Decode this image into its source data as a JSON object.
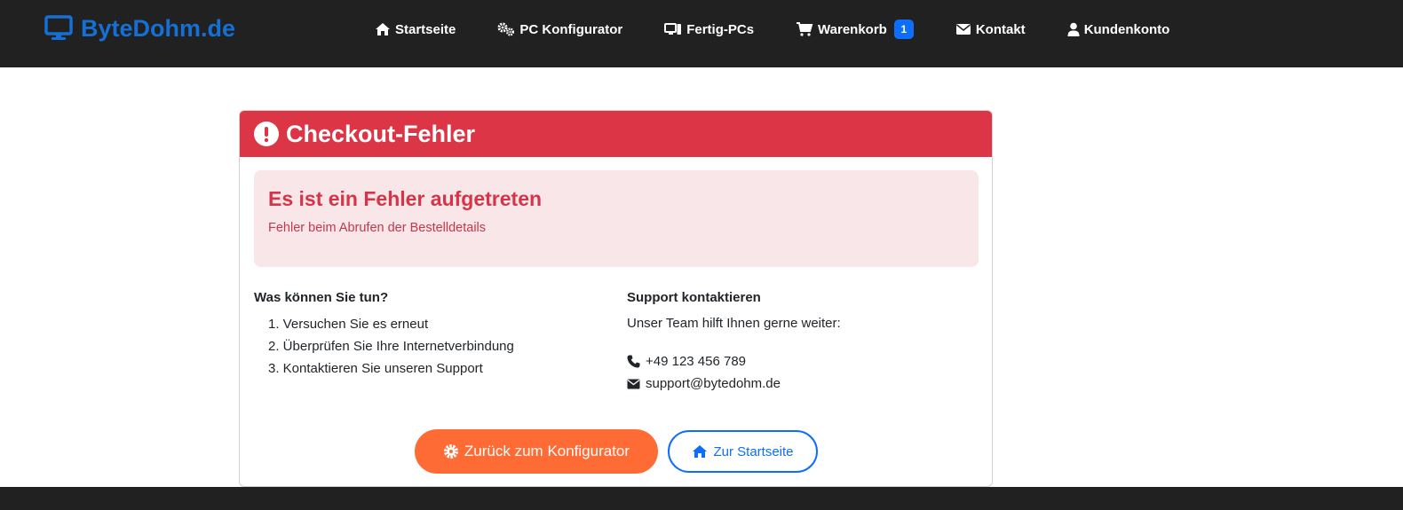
{
  "navbar": {
    "brand": {
      "label": "ByteDohm.de",
      "icon": "monitor-icon",
      "color": "#1570d6"
    },
    "items": [
      {
        "label": "Startseite",
        "icon": "home-icon"
      },
      {
        "label": "PC Konfigurator",
        "icon": "gears-icon"
      },
      {
        "label": "Fertig-PCs",
        "icon": "desktop-icon"
      },
      {
        "label": "Warenkorb",
        "icon": "cart-icon",
        "badge": "1"
      },
      {
        "label": "Kontakt",
        "icon": "envelope-icon"
      },
      {
        "label": "Kundenkonto",
        "icon": "user-icon"
      }
    ],
    "background": "#212121"
  },
  "card": {
    "title": "Checkout-Fehler",
    "header_icon": "exclamation-circle-icon",
    "header_color": "#dc3545",
    "alert": {
      "heading": "Es ist ein Fehler aufgetreten",
      "message": "Fehler beim Abrufen der Bestelldetails"
    },
    "steps": {
      "heading": "Was können Sie tun?",
      "items": [
        "1. Versuchen Sie es erneut",
        "2. Überprüfen Sie Ihre Internetverbindung",
        "3. Kontaktieren Sie unseren Support"
      ]
    },
    "support": {
      "heading": "Support kontaktieren",
      "text": "Unser Team hilft Ihnen gerne weiter:",
      "phone": "+49 123 456 789",
      "email": "support@bytedohm.de"
    },
    "buttons": {
      "configurator": {
        "label": "Zurück zum Konfigurator",
        "icon": "gear-icon",
        "color": "#ff6b35"
      },
      "home": {
        "label": "Zur Startseite",
        "icon": "home-icon",
        "color": "#0d6efd"
      }
    }
  }
}
